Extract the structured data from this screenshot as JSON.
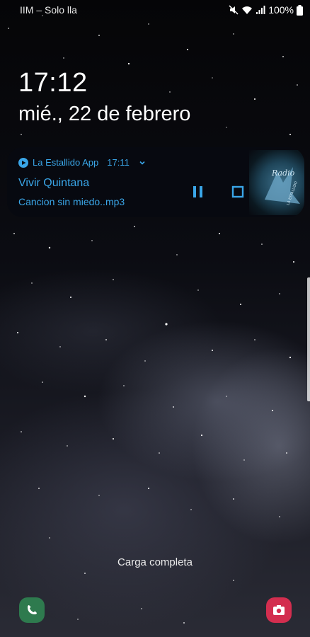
{
  "status_bar": {
    "carrier": "IIM – Solo lla",
    "battery": "100%",
    "icons": [
      "mute-icon",
      "wifi-icon",
      "signal-icon",
      "battery-icon"
    ]
  },
  "lockscreen": {
    "time": "17:12",
    "date": "mié., 22 de febrero"
  },
  "notification": {
    "app_name": "La Estallido App",
    "time": "17:11",
    "title": "Vivir Quintana",
    "subtitle": "Cancion sin miedo..mp3",
    "accent_color": "#3aa6e8",
    "art_text": "Radio",
    "art_text_2": "LA ESTALLIDO"
  },
  "footer": {
    "status_text": "Carga completa",
    "left_shortcut": "phone-icon",
    "right_shortcut": "camera-icon"
  }
}
